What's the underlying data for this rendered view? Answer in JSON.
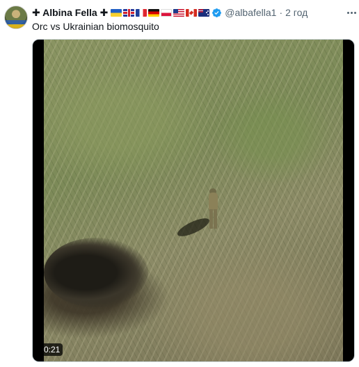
{
  "tweet": {
    "author_name": "✚ Albina Fella ✚",
    "flags": [
      "ukraine-flag-icon",
      "uk-flag-icon",
      "france-flag-icon",
      "germany-flag-icon",
      "poland-flag-icon",
      "usa-flag-icon",
      "canada-flag-icon",
      "australia-flag-icon"
    ],
    "verified_icon": "verified-badge-icon",
    "handle": "@albafella1",
    "separator": "·",
    "time": "2 год",
    "text": "Orc vs Ukrainian biomosquito",
    "more_icon": "more-options-icon"
  },
  "media": {
    "type": "video",
    "duration": "0:21"
  },
  "colors": {
    "verified_blue": "#1d9bf0",
    "secondary_text": "#536471",
    "primary_text": "#0f1419"
  }
}
